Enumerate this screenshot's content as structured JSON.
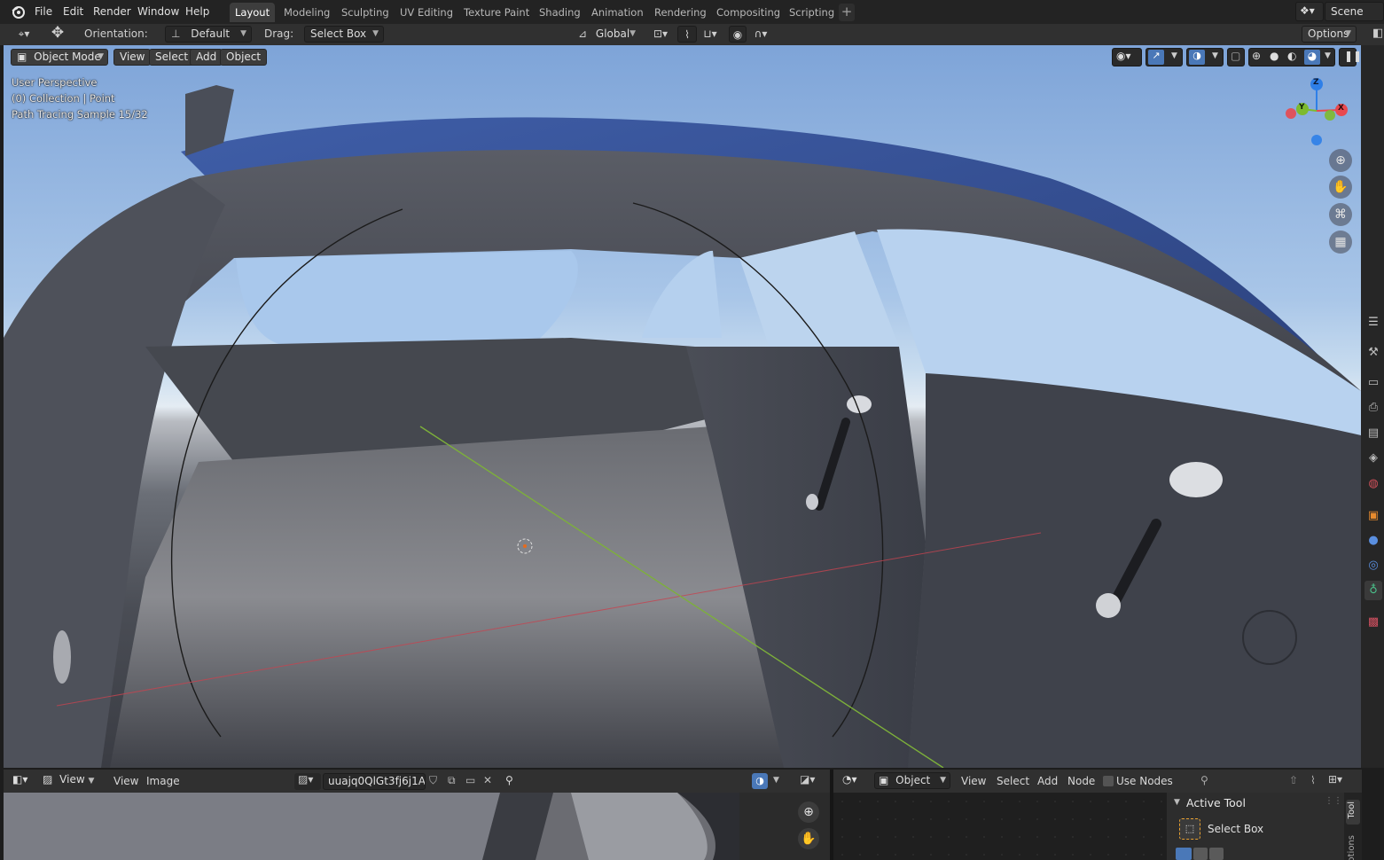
{
  "topbar": {
    "menus": [
      "File",
      "Edit",
      "Render",
      "Window",
      "Help"
    ],
    "workspaces": [
      "Layout",
      "Modeling",
      "Sculpting",
      "UV Editing",
      "Texture Paint",
      "Shading",
      "Animation",
      "Rendering",
      "Compositing",
      "Scripting"
    ],
    "active_workspace": "Layout",
    "add_tab": "+",
    "scene": "Scene"
  },
  "toolheader": {
    "orientation_label": "Orientation:",
    "orientation_value": "Default",
    "drag_label": "Drag:",
    "drag_value": "Select Box",
    "transform_orientation": "Global",
    "options": "Options"
  },
  "viewport": {
    "mode": "Object Mode",
    "menus": [
      "View",
      "Select",
      "Add",
      "Object"
    ],
    "overlay_lines": [
      "User Perspective",
      "(0) Collection | Point",
      "Path Tracing Sample 15/32"
    ],
    "gizmo_axes": {
      "z": "Z",
      "y": "Y",
      "x": "X"
    },
    "colors": {
      "x_axis": "#e8494f",
      "y_axis": "#7dba2e",
      "z_axis": "#2e7fe8"
    }
  },
  "image_editor": {
    "view_dropdown": "View",
    "menus": [
      "View",
      "Image"
    ],
    "image_name": "uuajq0QlGt3fj6j1A_..."
  },
  "node_editor": {
    "object_dropdown": "Object",
    "menus": [
      "View",
      "Select",
      "Add",
      "Node"
    ],
    "use_nodes_label": "Use Nodes",
    "use_nodes_checked": false
  },
  "sidebar": {
    "panel_title": "Active Tool",
    "tool_name": "Select Box",
    "tabs": [
      "Tool",
      "Options"
    ]
  }
}
